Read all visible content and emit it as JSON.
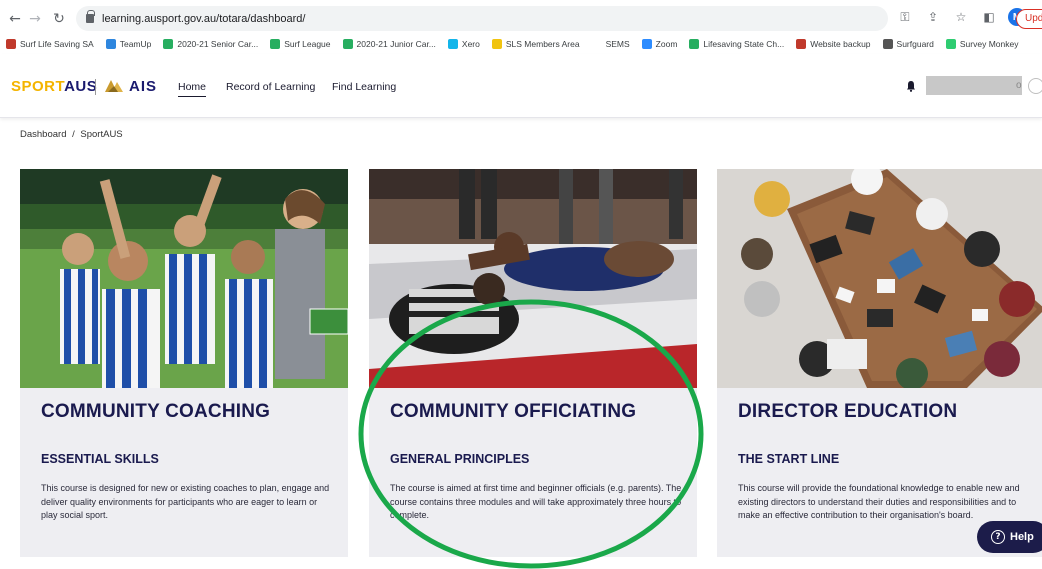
{
  "browser": {
    "url": "learning.ausport.gov.au/totara/dashboard/",
    "profile_initial": "M",
    "update_label": "Upda",
    "bookmarks": [
      {
        "label": "Surf Life Saving SA",
        "color": "#c0392b"
      },
      {
        "label": "TeamUp",
        "color": "#2e86de"
      },
      {
        "label": "2020-21 Senior Car...",
        "color": "#27ae60"
      },
      {
        "label": "Surf League",
        "color": "#27ae60"
      },
      {
        "label": "2020-21 Junior Car...",
        "color": "#27ae60"
      },
      {
        "label": "Xero",
        "color": "#13b5ea"
      },
      {
        "label": "SLS Members Area",
        "color": "#f1c40f"
      },
      {
        "label": "SEMS",
        "color": "#ffffff"
      },
      {
        "label": "Zoom",
        "color": "#2d8cff"
      },
      {
        "label": "Lifesaving State Ch...",
        "color": "#27ae60"
      },
      {
        "label": "Website backup",
        "color": "#c0392b"
      },
      {
        "label": "Surfguard",
        "color": "#555555"
      },
      {
        "label": "Survey Monkey",
        "color": "#2ecc71"
      }
    ]
  },
  "header": {
    "logo_sport": "SPORT",
    "logo_aus": "AUS",
    "logo_ais": "AIS",
    "nav": {
      "home": "Home",
      "record": "Record of Learning",
      "find": "Find Learning"
    },
    "user_suffix": "o"
  },
  "breadcrumb": {
    "dashboard": "Dashboard",
    "separator": "/",
    "current": "SportAUS"
  },
  "cards": [
    {
      "title": "COMMUNITY COACHING",
      "subtitle": "ESSENTIAL SKILLS",
      "description": "This course is designed for new or existing coaches to plan, engage and deliver quality environments for participants who are eager to learn or play social sport."
    },
    {
      "title": "COMMUNITY OFFICIATING",
      "subtitle": "GENERAL PRINCIPLES",
      "description": "The course is aimed at first time and beginner officials (e.g. parents). The course contains three modules and will take approximately three hours to complete."
    },
    {
      "title": "DIRECTOR EDUCATION",
      "subtitle": "THE START LINE",
      "description": "This course will provide the foundational knowledge to enable new and existing directors to understand their duties and responsibilities and to make an effective contribution to their organisation's board."
    }
  ],
  "help": {
    "label": "Help"
  },
  "colors": {
    "brand_navy": "#1a1a4e",
    "brand_gold": "#f4b400",
    "card_bg": "#eeeef2",
    "annotation": "#1aa84a"
  }
}
